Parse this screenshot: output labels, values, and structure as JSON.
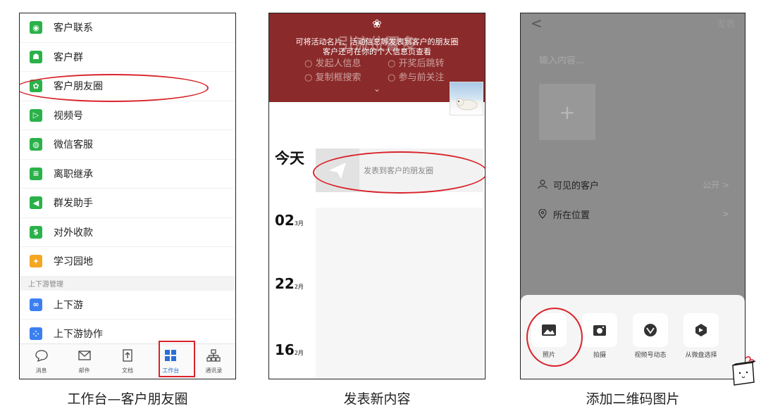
{
  "panel1": {
    "menu_items": [
      {
        "label": "客户联系",
        "color": "#2bb14a"
      },
      {
        "label": "客户群",
        "color": "#2bb14a"
      },
      {
        "label": "客户朋友圈",
        "color": "#2bb14a"
      },
      {
        "label": "视频号",
        "color": "#2bb14a"
      },
      {
        "label": "微信客服",
        "color": "#2bb14a"
      },
      {
        "label": "离职继承",
        "color": "#2bb14a"
      },
      {
        "label": "群发助手",
        "color": "#2bb14a"
      },
      {
        "label": "对外收款",
        "color": "#2bb14a"
      },
      {
        "label": "学习园地",
        "color": "#f5a623"
      }
    ],
    "section_label": "上下游管理",
    "section_items": [
      {
        "label": "上下游",
        "color": "#3b7ff0"
      },
      {
        "label": "上下游协作",
        "color": "#3b7ff0"
      }
    ],
    "tabs": [
      {
        "label": "消息",
        "icon": "chat-bubble-icon"
      },
      {
        "label": "邮件",
        "icon": "mail-icon"
      },
      {
        "label": "文档",
        "icon": "doc-icon"
      },
      {
        "label": "工作台",
        "icon": "workbench-grid-icon",
        "active": true
      },
      {
        "label": "通讯录",
        "icon": "contacts-tree-icon"
      }
    ],
    "caption": "工作台—客户朋友圈"
  },
  "panel2": {
    "banner_ghost": "引流位置多",
    "banner_line1": "可将活动名片、活动信息等发表到客户的朋友圈",
    "banner_line2": "客户还可在你的个人信息页查看",
    "options": [
      "发起人信息",
      "开奖后跳转",
      "复制框搜索",
      "参与前关注"
    ],
    "today": "今天",
    "post_text": "发表到客户的朋友圈",
    "dates": [
      {
        "day": "02",
        "month": "3月"
      },
      {
        "day": "22",
        "month": "2月"
      },
      {
        "day": "16",
        "month": "2月"
      }
    ],
    "caption": "发表新内容"
  },
  "panel3": {
    "back": "<",
    "publish": "发表",
    "input_placeholder": "输入内容...",
    "visible_label": "可见的客户",
    "visible_value": "公开 >",
    "location_label": "所在位置",
    "location_value": ">",
    "sheet_items": [
      {
        "label": "照片",
        "icon": "photo-icon"
      },
      {
        "label": "拍摄",
        "icon": "camera-icon"
      },
      {
        "label": "视频号动态",
        "icon": "channels-icon"
      },
      {
        "label": "从微盘选择",
        "icon": "weipan-icon"
      }
    ],
    "caption": "添加二维码图片"
  },
  "colors": {
    "accent_red": "#d9232a",
    "banner_red": "#8b2a2a",
    "active_blue": "#2a6ed8"
  }
}
